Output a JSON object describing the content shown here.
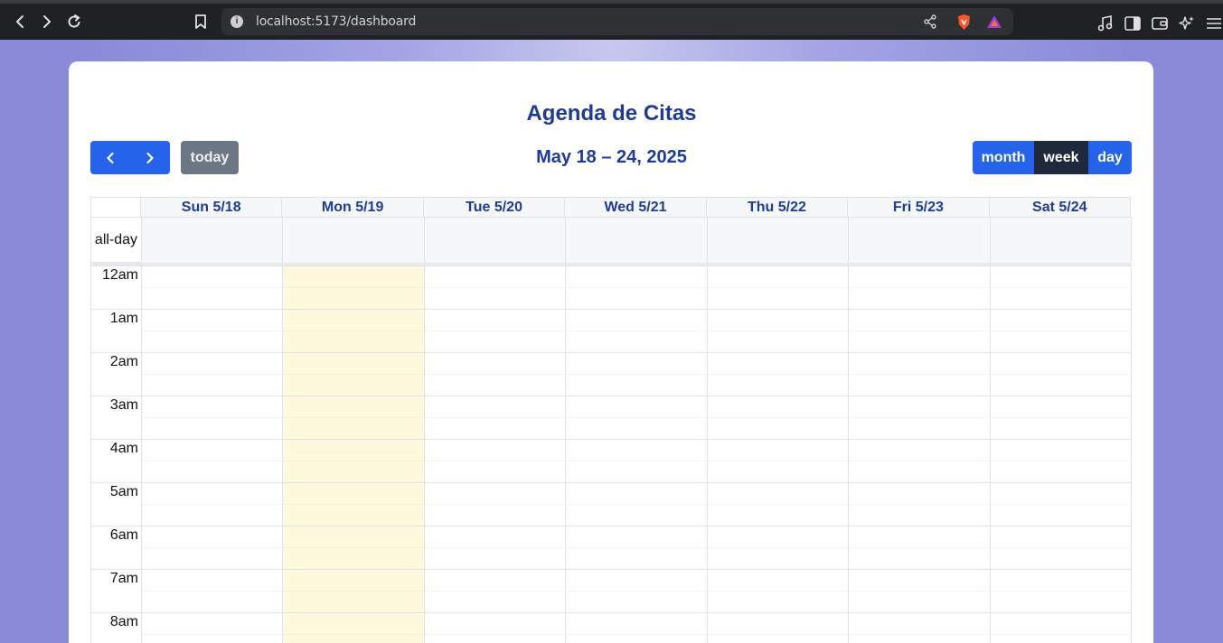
{
  "browser": {
    "url": "localhost:5173/dashboard",
    "icons": [
      "back-icon",
      "forward-icon",
      "reload-icon",
      "bookmark-icon",
      "site-info-icon",
      "share-icon",
      "brave-shields-icon",
      "brave-rewards-icon",
      "music-icon",
      "sidebar-icon",
      "wallet-icon",
      "leo-ai-icon",
      "menu-icon"
    ]
  },
  "calendar": {
    "title": "Agenda de Citas",
    "range": "May 18 – 24, 2025",
    "toolbar": {
      "today": "today",
      "month": "month",
      "week": "week",
      "day": "day",
      "active_view": "week"
    },
    "allday_label": "all-day",
    "days": [
      {
        "label": "Sun 5/18",
        "today": false
      },
      {
        "label": "Mon 5/19",
        "today": true
      },
      {
        "label": "Tue 5/20",
        "today": false
      },
      {
        "label": "Wed 5/21",
        "today": false
      },
      {
        "label": "Thu 5/22",
        "today": false
      },
      {
        "label": "Fri 5/23",
        "today": false
      },
      {
        "label": "Sat 5/24",
        "today": false
      }
    ],
    "hours": [
      "12am",
      "1am",
      "2am",
      "3am",
      "4am",
      "5am",
      "6am",
      "7am",
      "8am"
    ],
    "colors": {
      "primary": "#2563eb",
      "active": "#1e293b",
      "today_button": "#6b7785",
      "heading": "#1e3a9e",
      "today_column": "#fef8dd"
    }
  }
}
